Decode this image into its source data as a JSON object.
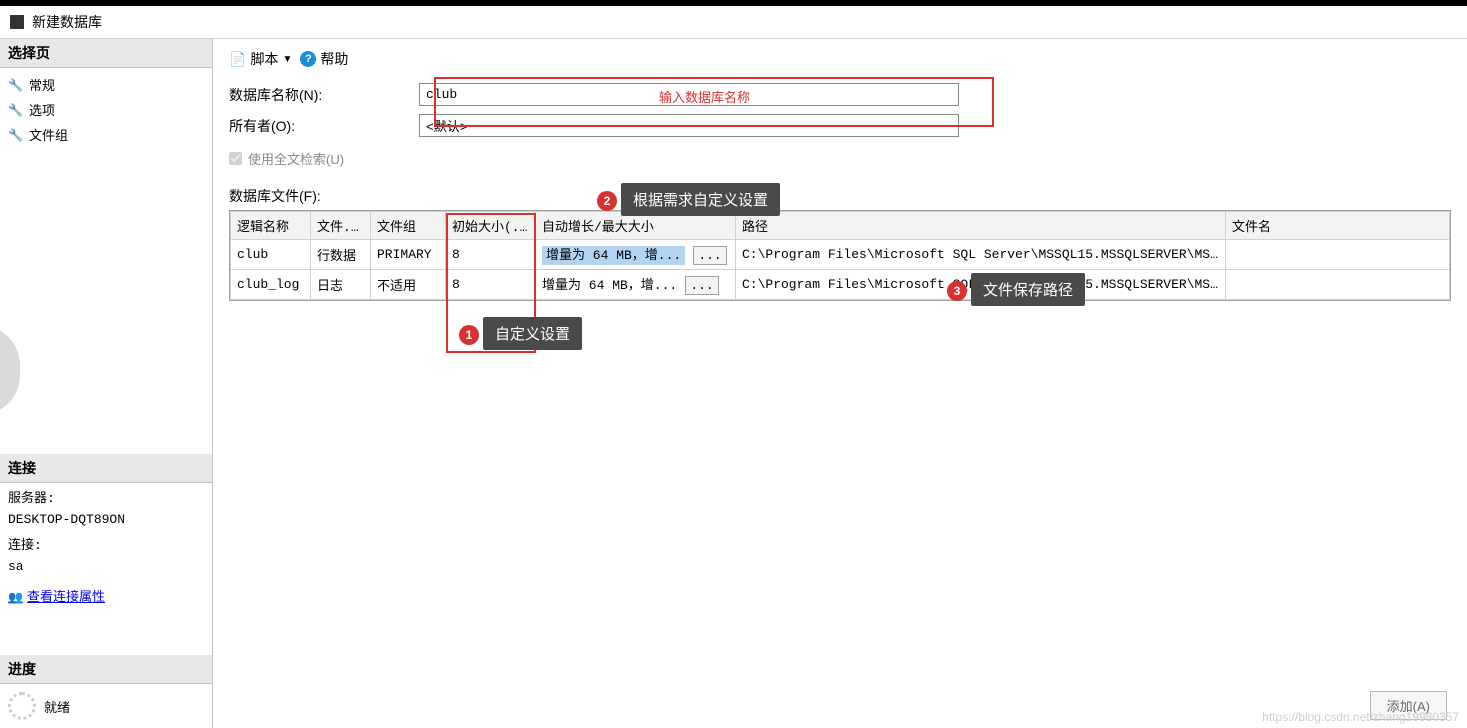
{
  "title": "新建数据库",
  "sidebar": {
    "pages_header": "选择页",
    "pages": [
      {
        "label": "常规"
      },
      {
        "label": "选项"
      },
      {
        "label": "文件组"
      }
    ],
    "connection_header": "连接",
    "server_label": "服务器:",
    "server_value": "DESKTOP-DQT89ON",
    "conn_label": "连接:",
    "conn_value": "sa",
    "view_props": "查看连接属性",
    "progress_header": "进度",
    "progress_status": "就绪"
  },
  "toolbar": {
    "script": "脚本",
    "help": "帮助"
  },
  "form": {
    "dbname_label": "数据库名称(N):",
    "dbname_value": "club",
    "owner_label": "所有者(O):",
    "owner_value": "<默认>",
    "fulltext_label": "使用全文检索(U)",
    "files_label": "数据库文件(F):"
  },
  "grid": {
    "headers": [
      "逻辑名称",
      "文件...",
      "文件组",
      "初始大小(...",
      "自动增长/最大大小",
      "路径",
      "文件名"
    ],
    "rows": [
      {
        "name": "club",
        "type": "行数据",
        "group": "PRIMARY",
        "size": "8",
        "growth": "增量为 64 MB，增...",
        "path": "C:\\Program Files\\Microsoft SQL Server\\MSSQL15.MSSQLSERVER\\MSS..."
      },
      {
        "name": "club_log",
        "type": "日志",
        "group": "不适用",
        "size": "8",
        "growth": "增量为 64 MB，增...",
        "path": "C:\\Program Files\\Microsoft SQL Server\\MSSQL15.MSSQLSERVER\\MSS..."
      }
    ]
  },
  "annotations": {
    "input_hint": "输入数据库名称",
    "bubble1": "自定义设置",
    "bubble2": "根据需求自定义设置",
    "bubble3": "文件保存路径"
  },
  "add_button": "添加(A)",
  "watermark": "https://blog.csdn.net/zhang19980357"
}
